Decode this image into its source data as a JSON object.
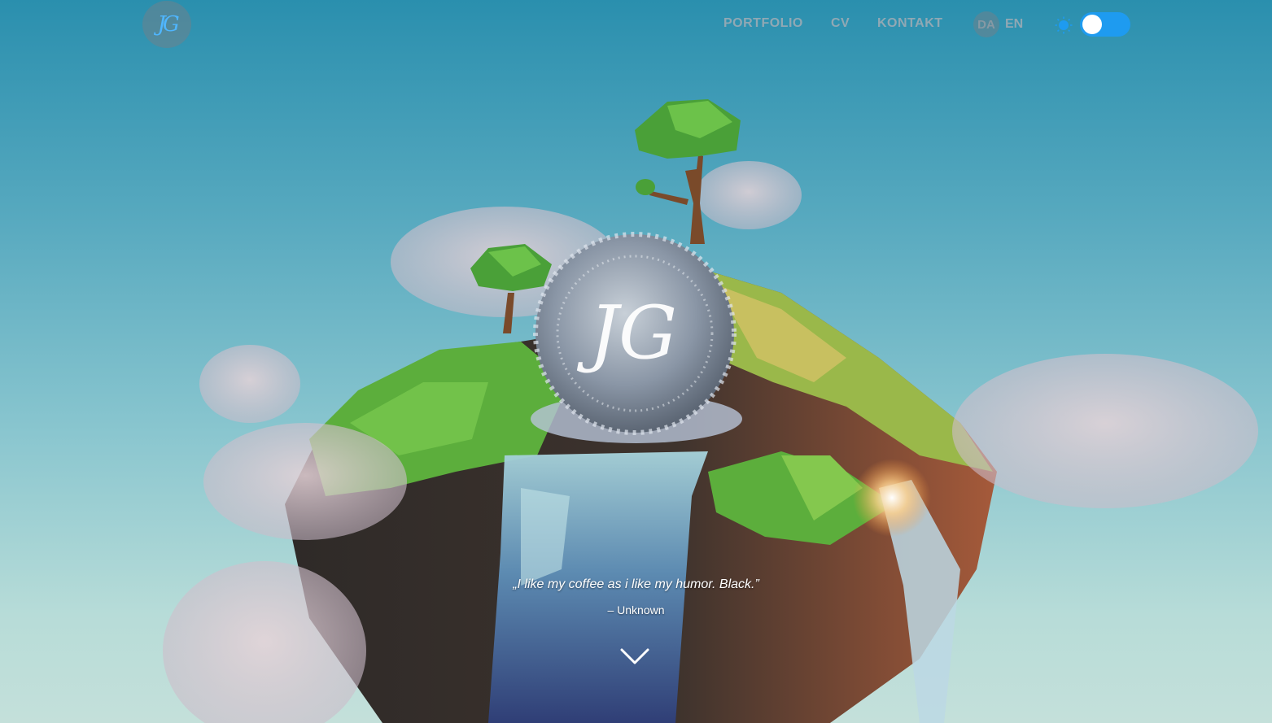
{
  "header": {
    "logo_label": "JG",
    "nav": [
      {
        "label": "PORTFOLIO"
      },
      {
        "label": "CV"
      },
      {
        "label": "KONTAKT"
      }
    ],
    "lang": {
      "da": "DA",
      "en": "EN"
    },
    "theme_toggle": {
      "left_icon": "sun-icon",
      "right_icon": "moon-icon",
      "state": "light"
    }
  },
  "hero": {
    "sphere_monogram": "JG",
    "quote": "„I like my coffee as i like my humor. Black.”",
    "author": "– Unknown",
    "scroll_icon": "chevron-down-icon"
  },
  "colors": {
    "accent": "#1e9bf0",
    "sky_top": "#2a8fae",
    "sky_bottom": "#c4e0da",
    "grass": "#5cae3c",
    "rock": "#4a3a30"
  }
}
